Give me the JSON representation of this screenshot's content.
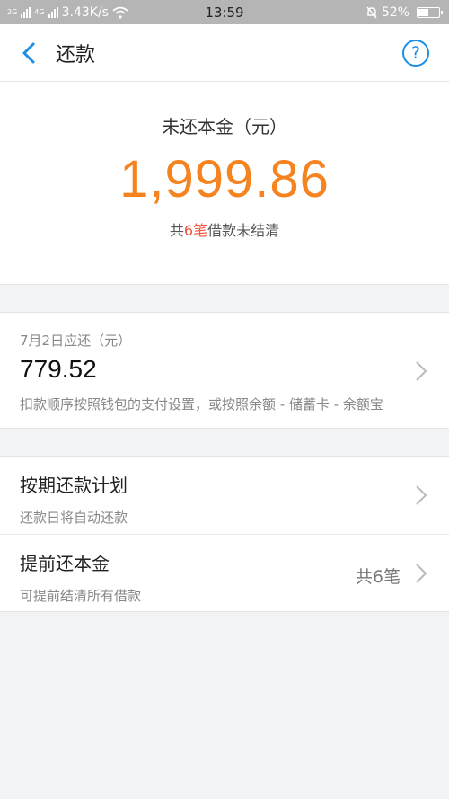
{
  "status_bar": {
    "net_left": "2G",
    "net_right": "4G",
    "speed": "3.43K/s",
    "time": "13:59",
    "battery": "52%",
    "battery_level": 0.52
  },
  "nav": {
    "title": "还款",
    "help_symbol": "?"
  },
  "summary": {
    "label": "未还本金（元）",
    "amount": "1,999.86",
    "sub_prefix": "共",
    "sub_count": "6笔",
    "sub_suffix": "借款未结清"
  },
  "due": {
    "label": "7月2日应还（元）",
    "amount": "779.52",
    "note": "扣款顺序按照钱包的支付设置，或按照余额 - 储蓄卡 - 余额宝"
  },
  "list": [
    {
      "title": "按期还款计划",
      "sub": "还款日将自动还款",
      "right": ""
    },
    {
      "title": "提前还本金",
      "sub": "可提前结清所有借款",
      "right": "共6笔"
    }
  ],
  "colors": {
    "accent": "#1b8fe6",
    "amount": "#f5831f",
    "highlight": "#f5503b"
  }
}
